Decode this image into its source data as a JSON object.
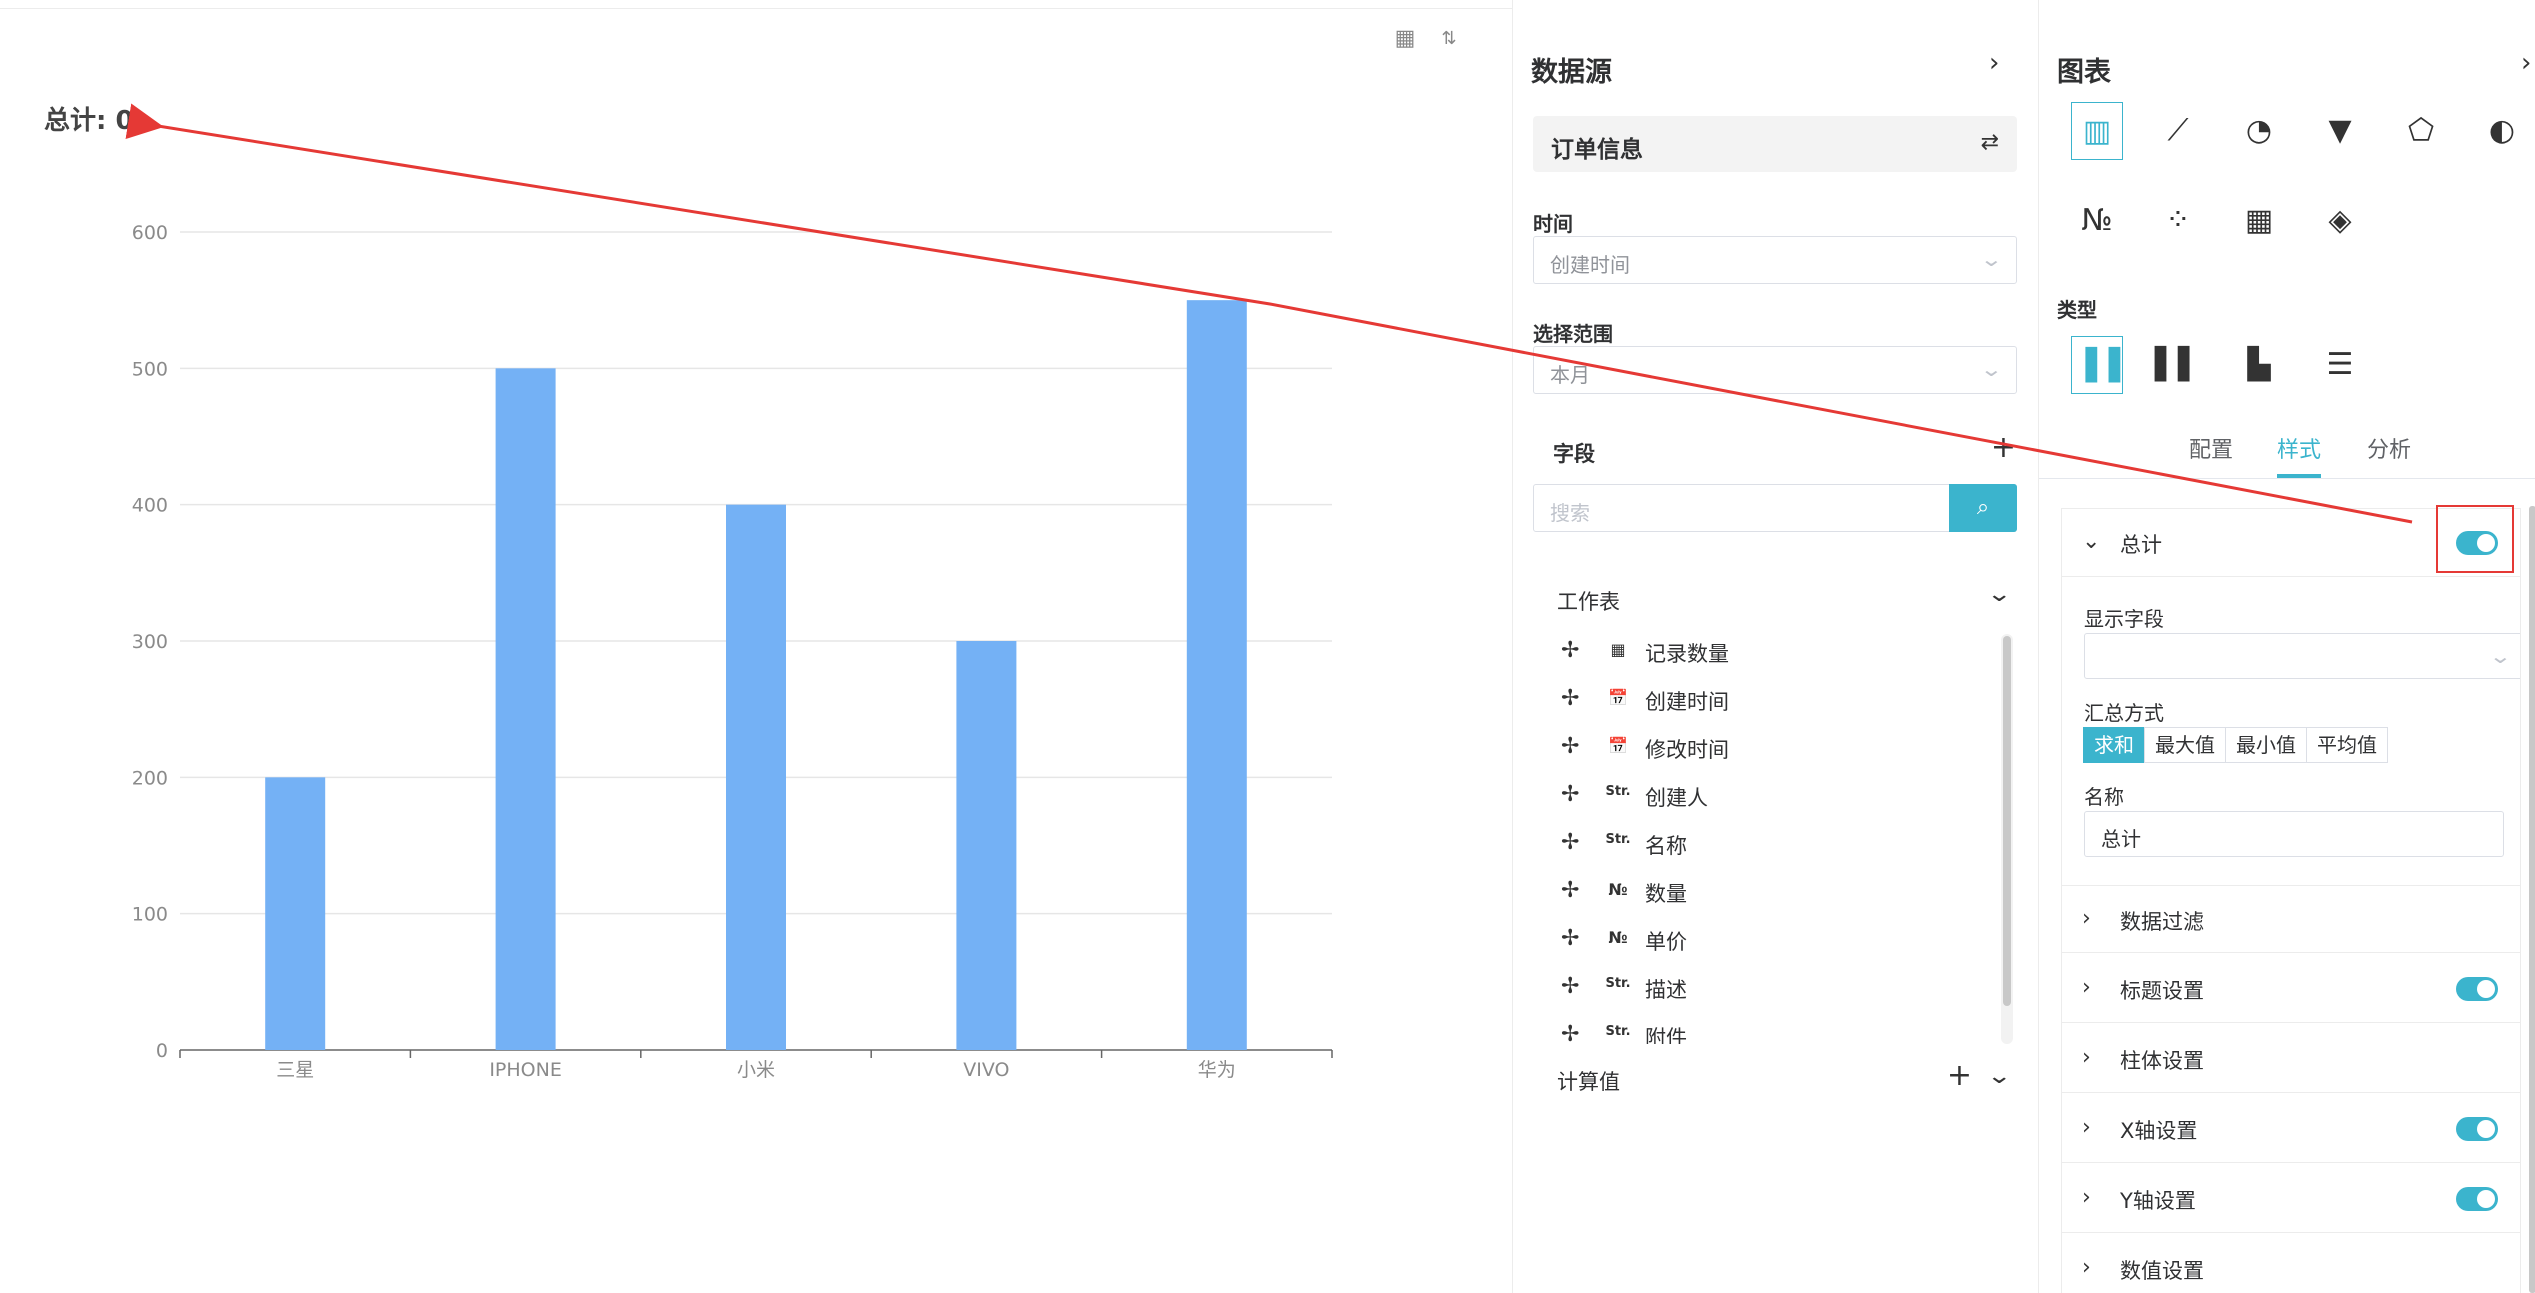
{
  "chart": {
    "total_label": "总计: 0",
    "toolbar_icons": [
      "table-view-icon",
      "sort-icon"
    ]
  },
  "chart_data": {
    "type": "bar",
    "categories": [
      "三星",
      "IPHONE",
      "小米",
      "VIVO",
      "华为"
    ],
    "values": [
      200,
      500,
      400,
      300,
      550
    ],
    "y_ticks": [
      0,
      100,
      200,
      300,
      400,
      500,
      600
    ],
    "ylim": [
      0,
      600
    ],
    "grid": true,
    "bar_color": "#74b1f5"
  },
  "datasource": {
    "title": "数据源",
    "source_name": "订单信息",
    "time_label": "时间",
    "time_value": "创建时间",
    "range_label": "选择范围",
    "range_value": "本月",
    "fields_label": "字段",
    "search_placeholder": "搜索",
    "worksheet_label": "工作表",
    "fields": [
      {
        "type": "calc-icon",
        "type_text": "▦",
        "name": "记录数量"
      },
      {
        "type": "calendar-icon",
        "type_text": "📅",
        "name": "创建时间"
      },
      {
        "type": "calendar-icon",
        "type_text": "📅",
        "name": "修改时间"
      },
      {
        "type": "string-icon",
        "type_text": "Str.",
        "name": "创建人"
      },
      {
        "type": "string-icon",
        "type_text": "Str.",
        "name": "名称"
      },
      {
        "type": "number-icon",
        "type_text": "№",
        "name": "数量"
      },
      {
        "type": "number-icon",
        "type_text": "№",
        "name": "单价"
      },
      {
        "type": "string-icon",
        "type_text": "Str.",
        "name": "描述"
      },
      {
        "type": "string-icon",
        "type_text": "Str.",
        "name": "附件"
      }
    ],
    "calc_label": "计算值"
  },
  "config": {
    "title": "图表",
    "chart_types": [
      {
        "icon": "bar-chart-icon",
        "glyph": "▥"
      },
      {
        "icon": "line-chart-icon",
        "glyph": "⟋"
      },
      {
        "icon": "pie-chart-icon",
        "glyph": "◔"
      },
      {
        "icon": "funnel-chart-icon",
        "glyph": "▼"
      },
      {
        "icon": "radar-chart-icon",
        "glyph": "⬠"
      },
      {
        "icon": "gauge-chart-icon",
        "glyph": "◐"
      },
      {
        "icon": "number-card-icon",
        "glyph": "№"
      },
      {
        "icon": "scatter-chart-icon",
        "glyph": "⁘"
      },
      {
        "icon": "table-chart-icon",
        "glyph": "▦"
      },
      {
        "icon": "map-chart-icon",
        "glyph": "◈"
      }
    ],
    "type_label": "类型",
    "sub_types": [
      {
        "icon": "grouped-bar-icon",
        "glyph": "▐▐"
      },
      {
        "icon": "stacked-bar-icon",
        "glyph": "▌▌"
      },
      {
        "icon": "basic-bar-icon",
        "glyph": "▙"
      },
      {
        "icon": "horizontal-bar-icon",
        "glyph": "☰"
      }
    ],
    "tabs": [
      "配置",
      "样式",
      "分析"
    ],
    "active_tab": "样式",
    "total_section": {
      "title": "总计",
      "enabled": true,
      "display_field_label": "显示字段",
      "display_field_value": "",
      "agg_label": "汇总方式",
      "agg_options": [
        "求和",
        "最大值",
        "最小值",
        "平均值"
      ],
      "agg_selected": "求和",
      "name_label": "名称",
      "name_value": "总计"
    },
    "sections": [
      {
        "title": "数据过滤",
        "toggle": false
      },
      {
        "title": "标题设置",
        "toggle": true
      },
      {
        "title": "柱体设置",
        "toggle": false
      },
      {
        "title": "X轴设置",
        "toggle": true
      },
      {
        "title": "Y轴设置",
        "toggle": true
      },
      {
        "title": "数值设置",
        "toggle": false
      }
    ]
  },
  "colors": {
    "accent": "#3bb4cd",
    "annotation": "#e53935"
  }
}
